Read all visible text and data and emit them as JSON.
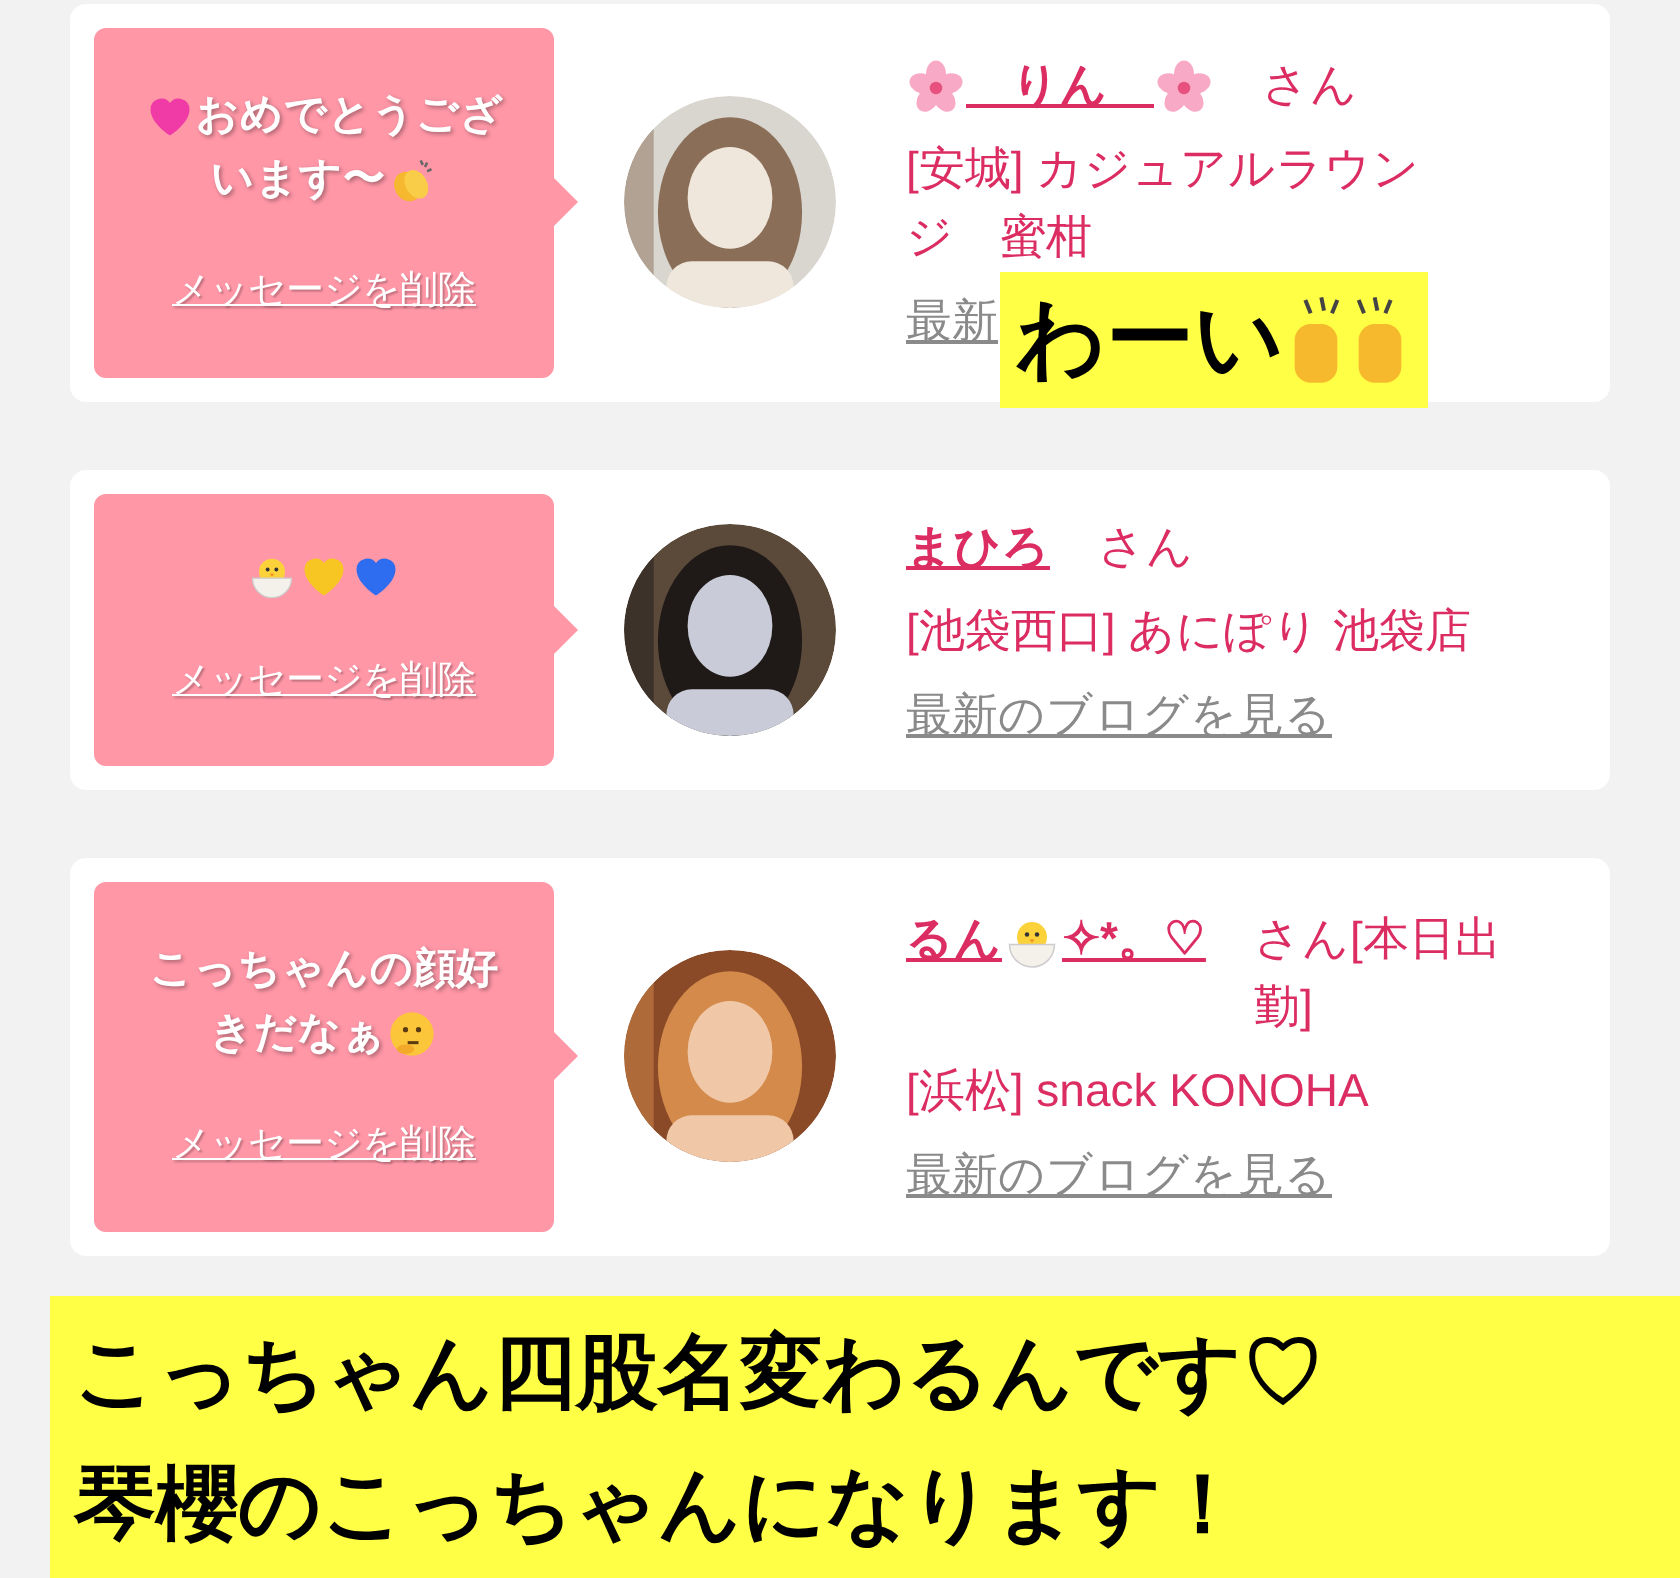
{
  "cards": [
    {
      "message": [
        [
          {
            "kind": "heart",
            "color": "#f03aa6"
          },
          {
            "kind": "text",
            "text": "おめでとうござ"
          }
        ],
        [
          {
            "kind": "text",
            "text": "います〜"
          },
          {
            "kind": "clap"
          }
        ]
      ],
      "delete_link": "メッセージを削除",
      "name": [
        {
          "kind": "blossom"
        },
        {
          "kind": "text",
          "text": "　りん　"
        },
        {
          "kind": "blossom"
        }
      ],
      "honorific": "さん",
      "shop": "[安城] カジュアルラウンジ　蜜柑",
      "blog_link": "最新"
    },
    {
      "message": [
        [
          {
            "kind": "chick"
          },
          {
            "kind": "heart",
            "color": "#f8c623"
          },
          {
            "kind": "heart",
            "color": "#2f6df0"
          }
        ]
      ],
      "delete_link": "メッセージを削除",
      "name": [
        {
          "kind": "text",
          "text": "まひろ"
        }
      ],
      "honorific": "さん",
      "shop": "[池袋西口] あにぽり 池袋店",
      "blog_link": "最新のブログを見る"
    },
    {
      "message": [
        [
          {
            "kind": "text",
            "text": "こっちゃんの顔好"
          }
        ],
        [
          {
            "kind": "text",
            "text": "きだなぁ"
          },
          {
            "kind": "thinking"
          }
        ]
      ],
      "delete_link": "メッセージを削除",
      "name": [
        {
          "kind": "text",
          "text": "るん"
        },
        {
          "kind": "chick"
        },
        {
          "kind": "text",
          "text": "✧*。♡"
        }
      ],
      "honorific": "さん[本日出勤]",
      "shop": "[浜松] snack KONOHA",
      "blog_link": "最新のブログを見る"
    }
  ],
  "captions": [
    {
      "parts": [
        {
          "kind": "text",
          "text": "わーい"
        },
        {
          "kind": "hands"
        }
      ]
    },
    {
      "parts": [
        {
          "kind": "text",
          "text": "こっちゃん四股名変わるんです♡\n琴櫻のこっちゃんになります！"
        }
      ]
    }
  ]
}
